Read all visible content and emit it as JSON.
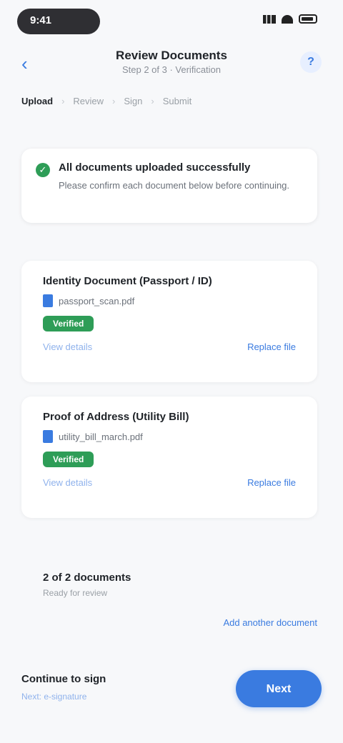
{
  "status": {
    "time": "9:41"
  },
  "header": {
    "title": "Review Documents",
    "subtitle": "Step 2 of 3 · Verification"
  },
  "steps": [
    "Upload",
    "Review",
    "Sign",
    "Submit"
  ],
  "notice": {
    "title": "All documents uploaded successfully",
    "text": "Please confirm each document below before continuing."
  },
  "cards": [
    {
      "title": "Identity Document (Passport / ID)",
      "file": "passport_scan.pdf",
      "badge": "Verified",
      "left_link": "View details",
      "right_link": "Replace file"
    },
    {
      "title": "Proof of Address (Utility Bill)",
      "file": "utility_bill_march.pdf",
      "badge": "Verified",
      "left_link": "View details",
      "right_link": "Replace file"
    }
  ],
  "totals": {
    "title": "2 of 2 documents",
    "subtitle": "Ready for review",
    "link": "Add another document"
  },
  "footer": {
    "label": "Continue to sign",
    "sublabel": "Next: e-signature",
    "button": "Next"
  }
}
